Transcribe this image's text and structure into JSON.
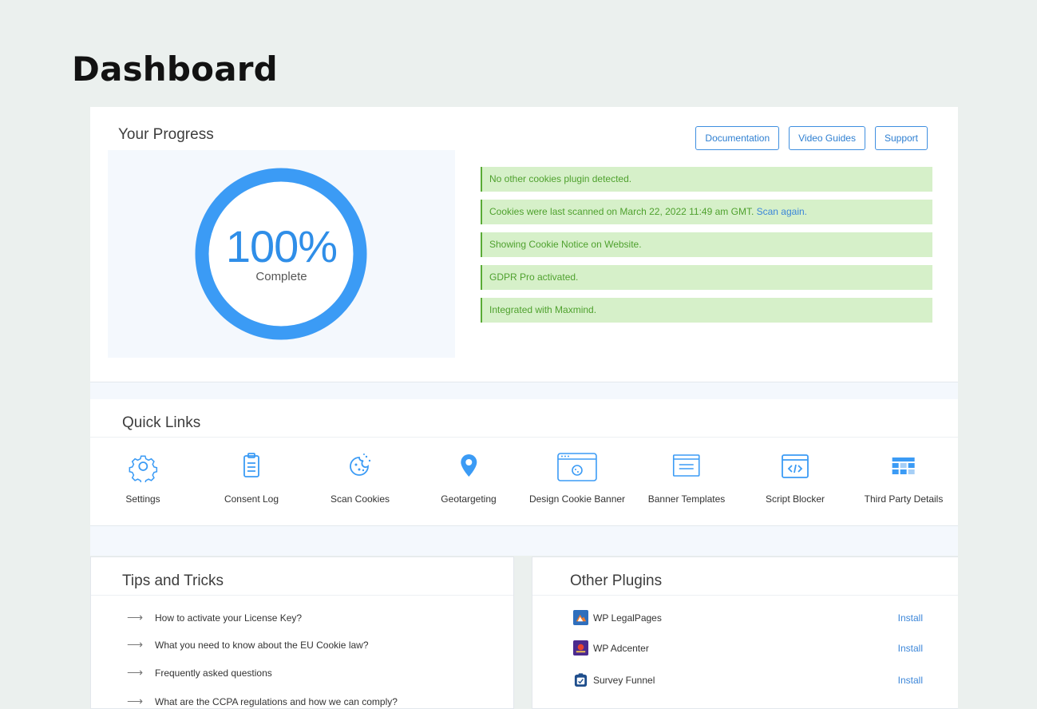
{
  "page": {
    "title": "Dashboard"
  },
  "progress": {
    "heading": "Your Progress",
    "percent_text": "100%",
    "percent_value": 100,
    "label": "Complete",
    "ring_color": "#3b9bf5",
    "buttons": [
      "Documentation",
      "Video Guides",
      "Support"
    ],
    "status": [
      {
        "text": "No other cookies plugin detected.",
        "link": ""
      },
      {
        "text": "Cookies were last scanned on March 22, 2022 11:49 am GMT. ",
        "link": "Scan again."
      },
      {
        "text": "Showing Cookie Notice on Website.",
        "link": ""
      },
      {
        "text": "GDPR Pro activated.",
        "link": ""
      },
      {
        "text": "Integrated with Maxmind.",
        "link": ""
      }
    ]
  },
  "quick_links": {
    "heading": "Quick Links",
    "items": [
      {
        "label": "Settings",
        "icon": "gear-icon"
      },
      {
        "label": "Consent Log",
        "icon": "clipboard-icon"
      },
      {
        "label": "Scan Cookies",
        "icon": "cookie-icon"
      },
      {
        "label": "Geotargeting",
        "icon": "map-pin-icon"
      },
      {
        "label": "Design Cookie Banner",
        "icon": "browser-cookie-icon"
      },
      {
        "label": "Banner Templates",
        "icon": "banner-template-icon"
      },
      {
        "label": "Script Blocker",
        "icon": "code-window-icon"
      },
      {
        "label": "Third Party Details",
        "icon": "table-icon"
      }
    ]
  },
  "tips": {
    "heading": "Tips and Tricks",
    "items": [
      "How to activate your License Key?",
      "What you need to know about the EU Cookie law?",
      "Frequently asked questions",
      "What are the CCPA regulations and how we can comply?"
    ]
  },
  "plugins": {
    "heading": "Other Plugins",
    "install_label": "Install",
    "items": [
      {
        "name": "WP LegalPages",
        "icon": "wp-legalpages-logo-icon"
      },
      {
        "name": "WP Adcenter",
        "icon": "wp-adcenter-logo-icon"
      },
      {
        "name": "Survey Funnel",
        "icon": "survey-funnel-logo-icon"
      }
    ]
  }
}
